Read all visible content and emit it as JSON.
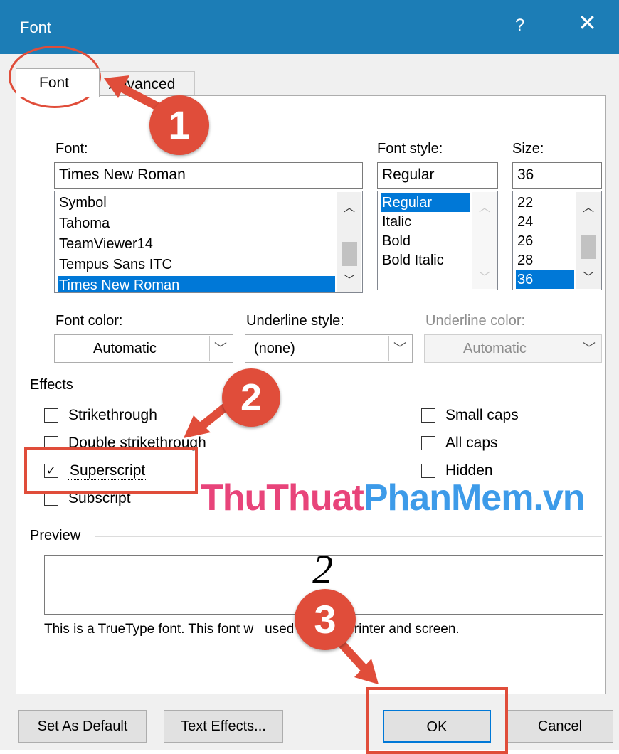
{
  "window": {
    "title": "Font",
    "help": "?",
    "close": "✕"
  },
  "tabs": [
    {
      "label": "Font"
    },
    {
      "label": "Advanced"
    }
  ],
  "font": {
    "label": "Font:",
    "value": "Times New Roman",
    "list": [
      "Symbol",
      "Tahoma",
      "TeamViewer14",
      "Tempus Sans ITC",
      "Times New Roman"
    ]
  },
  "font_style": {
    "label": "Font style:",
    "value": "Regular",
    "list": [
      "Regular",
      "Italic",
      "Bold",
      "Bold Italic"
    ]
  },
  "size": {
    "label": "Size:",
    "value": "36",
    "list": [
      "22",
      "24",
      "26",
      "28",
      "36"
    ]
  },
  "font_color": {
    "label": "Font color:",
    "value": "Automatic"
  },
  "underline_style": {
    "label": "Underline style:",
    "value": "(none)"
  },
  "underline_color": {
    "label": "Underline color:",
    "value": "Automatic"
  },
  "effects": {
    "label": "Effects",
    "left": [
      {
        "label": "Strikethrough",
        "checked": false
      },
      {
        "label": "Double strikethrough",
        "checked": false
      },
      {
        "label": "Superscript",
        "checked": true
      },
      {
        "label": "Subscript",
        "checked": false
      }
    ],
    "right": [
      {
        "label": "Small caps",
        "checked": false
      },
      {
        "label": "All caps",
        "checked": false
      },
      {
        "label": "Hidden",
        "checked": false
      }
    ]
  },
  "preview": {
    "label": "Preview",
    "glyph": "2",
    "note": "This is a TrueType font. This font w   used on both printer and screen."
  },
  "buttons": {
    "set_default": "Set As Default",
    "text_effects": "Text Effects...",
    "ok": "OK",
    "cancel": "Cancel"
  },
  "annotations": {
    "step1": "1",
    "step2": "2",
    "step3": "3"
  },
  "watermark": {
    "part1": "ThuThuat",
    "part2": "PhanMem.vn"
  },
  "colors": {
    "titlebar": "#1c7db6",
    "selection": "#0078d7",
    "annotation": "#e04d3a"
  }
}
